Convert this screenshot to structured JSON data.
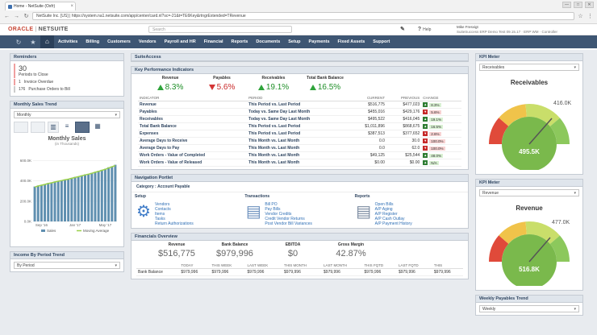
{
  "browser": {
    "tab_title": "Home - NetSuite (Oxfr)",
    "url": "NetSuite Inc. [US]  |  https://system.na1.netsuite.com/app/center/card.nl?sc=-21&t=TE6Key&rtngrExtended=TRevenue",
    "window_controls": [
      "—",
      "□",
      "✕"
    ]
  },
  "header": {
    "logo_oracle": "ORACLE",
    "logo_netsuite": "NETSUITE",
    "search_placeholder": "Search",
    "help": "Help",
    "user_name": "Mike Fresvigt",
    "user_role": "SuiteSuccess ERP Demo Test 09.15.17 · ERP WM · Controller"
  },
  "menu": [
    "Activities",
    "Billing",
    "Customers",
    "Vendors",
    "Payroll and HR",
    "Financial",
    "Reports",
    "Documents",
    "Setup",
    "Payments",
    "Fixed Assets",
    "Support"
  ],
  "reminders": {
    "title": "Reminders",
    "items": [
      {
        "count": "30",
        "label": "Periods to Close"
      },
      {
        "count": "1",
        "label": "Invoice Overdue"
      },
      {
        "count": "176",
        "label": "Purchase Orders to Bill"
      }
    ]
  },
  "monthly_sales": {
    "title": "Monthly Sales Trend",
    "select": "Monthly",
    "chart_title": "Monthly Sales",
    "chart_subtitle": "(in Thousands)",
    "legend_sales": "Sales",
    "legend_avg": "Moving Average"
  },
  "income_by_period": {
    "title": "Income By Period Trend",
    "select": "By Period"
  },
  "suiteaccess": {
    "title": "SuiteAccess"
  },
  "kpi": {
    "title": "Key Performance Indicators",
    "headline": [
      {
        "label": "Revenue",
        "value": "8.3%",
        "dir": "up"
      },
      {
        "label": "Payables",
        "value": "5.6%",
        "dir": "down"
      },
      {
        "label": "Receivables",
        "value": "19.1%",
        "dir": "up"
      },
      {
        "label": "Total Bank Balance",
        "value": "16.5%",
        "dir": "up"
      }
    ],
    "columns": [
      "INDICATOR",
      "PERIOD",
      "CURRENT",
      "PREVIOUS",
      "CHANGE"
    ],
    "rows": [
      {
        "ind": "Revenue",
        "period": "This Period vs. Last Period",
        "cur": "$516,775",
        "prev": "$477,023",
        "pos": true,
        "chg": "8.3%"
      },
      {
        "ind": "Payables",
        "period": "Today vs. Same Day Last Month",
        "cur": "$455,016",
        "prev": "$429,176",
        "pos": false,
        "chg": "5.6%"
      },
      {
        "ind": "Receivables",
        "period": "Today vs. Same Day Last Month",
        "cur": "$495,522",
        "prev": "$416,045",
        "pos": true,
        "chg": "19.1%"
      },
      {
        "ind": "Total Bank Balance",
        "period": "This Period vs. Last Period",
        "cur": "$1,011,896",
        "prev": "$868,675",
        "pos": true,
        "chg": "16.5%"
      },
      {
        "ind": "Expenses",
        "period": "This Period vs. Last Period",
        "cur": "$387,513",
        "prev": "$377,652",
        "pos": false,
        "chg": "2.6%"
      },
      {
        "ind": "Average Days to Receive",
        "period": "This Month vs. Last Month",
        "cur": "0.0",
        "prev": "30.0",
        "pos": false,
        "chg": "100.0%"
      },
      {
        "ind": "Average Days to Pay",
        "period": "This Month vs. Last Month",
        "cur": "0.0",
        "prev": "62.0",
        "pos": false,
        "chg": "100.0%"
      },
      {
        "ind": "Work Orders - Value of Completed",
        "period": "This Month vs. Last Month",
        "cur": "$49,125",
        "prev": "$25,544",
        "pos": true,
        "chg": "48.0%"
      },
      {
        "ind": "Work Orders - Value of Released",
        "period": "This Month vs. Last Month",
        "cur": "$0.00",
        "prev": "$0.00",
        "pos": true,
        "chg": "N/A"
      }
    ]
  },
  "nav_portlet": {
    "title": "Navigation Portlet",
    "category_label": "Category :",
    "category": "Account Payable",
    "setup": {
      "head": "Setup",
      "links": [
        "Vendors",
        "Contacts",
        "Items",
        "Tasks",
        "Return Authorizations"
      ]
    },
    "transactions": {
      "head": "Transactions",
      "links": [
        "Bill PO",
        "Pay Bills",
        "Vendor Credits",
        "Credit Vendor Returns",
        "Post Vendor Bill Variances"
      ]
    },
    "reports": {
      "head": "Reports",
      "links": [
        "Open Bills",
        "A/P Aging",
        "A/P Register",
        "A/P Cash Outlay",
        "A/P Payment History"
      ]
    }
  },
  "financials": {
    "title": "Financials Overview",
    "headline": [
      {
        "label": "Revenue",
        "value": "$516,775"
      },
      {
        "label": "Bank Balance",
        "value": "$979,996"
      },
      {
        "label": "EBITDA",
        "value": "$0"
      },
      {
        "label": "Gross Margin",
        "value": "42.87%"
      }
    ],
    "columns": [
      "",
      "TODAY",
      "THIS WEEK",
      "LAST WEEK",
      "THIS MONTH",
      "LAST MONTH",
      "THIS FQTD",
      "LAST FQTD",
      "THIS"
    ],
    "row": [
      "Bank Balance",
      "$979,996",
      "$979,996",
      "$979,996",
      "$979,996",
      "$979,996",
      "$979,996",
      "$979,996",
      "$979,996"
    ]
  },
  "kpi_meter_1": {
    "title": "KPI Meter",
    "select": "Receivables",
    "label": "Receivables",
    "max": "416.0K",
    "value": "495.5K"
  },
  "kpi_meter_2": {
    "title": "KPI Meter",
    "select": "Revenue",
    "label": "Revenue",
    "max": "477.0K",
    "value": "516.8K"
  },
  "weekly_payables": {
    "title": "Weekly Payables Trend",
    "select": "Weekly"
  },
  "chart_data": {
    "type": "bar",
    "title": "Monthly Sales",
    "subtitle": "(in Thousands)",
    "x_ticks": [
      "Sep '16",
      "Jan '17",
      "May '17"
    ],
    "y_ticks": [
      "0.0K",
      "200.0K",
      "400.0K",
      "600.0K"
    ],
    "ylim": [
      0,
      700
    ],
    "series": [
      {
        "name": "Sales",
        "values": [
          345,
          355,
          360,
          370,
          380,
          385,
          395,
          400,
          405,
          415,
          420,
          430,
          440,
          445,
          455,
          465,
          470,
          480,
          490,
          500,
          510,
          520,
          535,
          545,
          560
        ]
      },
      {
        "name": "Moving Average",
        "values": [
          340,
          350,
          358,
          366,
          375,
          382,
          390,
          398,
          404,
          412,
          418,
          426,
          435,
          442,
          451,
          460,
          467,
          476,
          486,
          495,
          505,
          515,
          528,
          540,
          552
        ]
      }
    ],
    "legend": "bottom"
  }
}
